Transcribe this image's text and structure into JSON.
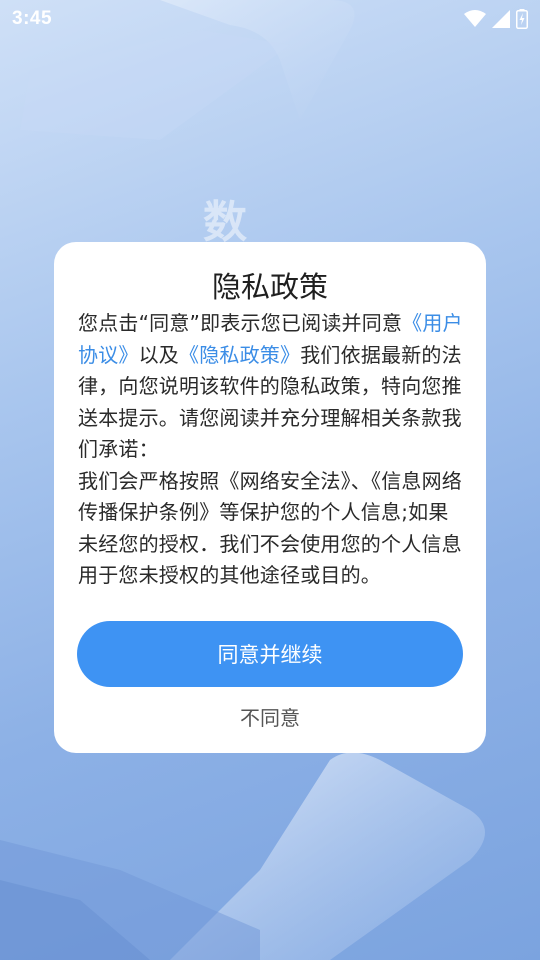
{
  "status_bar": {
    "time": "3:45",
    "icons": [
      "wifi-icon",
      "signal-icon",
      "battery-charging-icon"
    ]
  },
  "background": {
    "char": "数"
  },
  "dialog": {
    "title": "隐私政策",
    "para1": {
      "prefix": "您点击“同意”即表示您已阅读并同意",
      "link_user_agreement": "《用户协议》",
      "middle": "以及",
      "link_privacy_policy": "《隐私政策》",
      "suffix": "我们依据最新的法律，向您说明该软件的隐私政策，特向您推送本提示。请您阅读并充分理解相关条款我们承诺："
    },
    "para2": "我们会严格按照《网络安全法》、《信息网络传播保护条例》等保护您的个人信息;如果未经您的授权．我们不会使用您的个人信息用于您未授权的其他途径或目的。",
    "agree_label": "同意并继续",
    "disagree_label": "不同意"
  },
  "colors": {
    "accent": "#3e93f3",
    "link": "#3b8de6"
  }
}
